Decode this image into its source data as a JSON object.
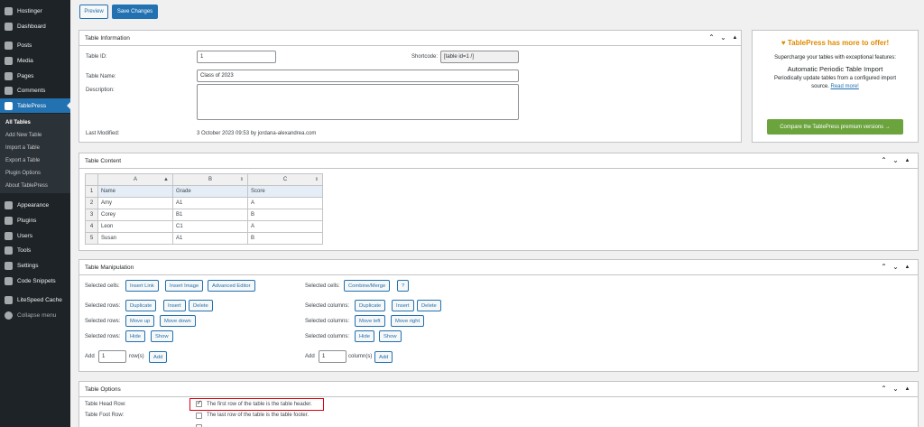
{
  "sidebar": {
    "top": [
      {
        "label": "Hostinger",
        "icon": "hostinger-icon"
      },
      {
        "label": "Dashboard",
        "icon": "dashboard-icon"
      },
      {
        "label": "Posts",
        "icon": "pin-icon"
      },
      {
        "label": "Media",
        "icon": "media-icon"
      },
      {
        "label": "Pages",
        "icon": "pages-icon"
      },
      {
        "label": "Comments",
        "icon": "comments-icon"
      },
      {
        "label": "TablePress",
        "icon": "tablepress-icon"
      }
    ],
    "submenu": [
      "All Tables",
      "Add New Table",
      "Import a Table",
      "Export a Table",
      "Plugin Options",
      "About TablePress"
    ],
    "bottom": [
      {
        "label": "Appearance",
        "icon": "brush-icon"
      },
      {
        "label": "Plugins",
        "icon": "plug-icon"
      },
      {
        "label": "Users",
        "icon": "users-icon"
      },
      {
        "label": "Tools",
        "icon": "wrench-icon"
      },
      {
        "label": "Settings",
        "icon": "settings-icon"
      },
      {
        "label": "Code Snippets",
        "icon": "code-icon"
      },
      {
        "label": "LiteSpeed Cache",
        "icon": "litespeed-icon"
      },
      {
        "label": "Collapse menu",
        "icon": "collapse-icon"
      }
    ]
  },
  "toolbar": {
    "preview_label": "Preview",
    "save_label": "Save Changes"
  },
  "info": {
    "title": "Table Information",
    "id_label": "Table ID:",
    "id_value": "1",
    "shortcode_label": "Shortcode:",
    "shortcode_value": "[table id=1 /]",
    "name_label": "Table Name:",
    "name_value": "Class of 2023",
    "desc_label": "Description:",
    "desc_value": "",
    "modified_label": "Last Modified:",
    "modified_value": "3 October 2023 09:53 by jordana-alexandrea.com"
  },
  "promo": {
    "title": "TablePress has more to offer!",
    "line1": "Supercharge your tables with exceptional features:",
    "feature": "Automatic Periodic Table Import",
    "desc1": "Periodically update tables from a configured import",
    "desc2_prefix": "source.",
    "link": "Read more!",
    "button": "Compare the TablePress premium versions"
  },
  "content": {
    "title": "Table Content",
    "columns": [
      "A",
      "B",
      "C"
    ],
    "rows": [
      {
        "num": "1",
        "cells": [
          "Name",
          "Grade",
          "Score"
        ]
      },
      {
        "num": "2",
        "cells": [
          "Amy",
          "A1",
          "A"
        ]
      },
      {
        "num": "3",
        "cells": [
          "Corey",
          "B1",
          "B"
        ]
      },
      {
        "num": "4",
        "cells": [
          "Leon",
          "C1",
          "A"
        ]
      },
      {
        "num": "5",
        "cells": [
          "Susan",
          "A1",
          "B"
        ]
      }
    ]
  },
  "manip": {
    "title": "Table Manipulation",
    "sel_cells": "Selected cells:",
    "insert_link": "Insert Link",
    "insert_image": "Insert Image",
    "advanced_editor": "Advanced Editor",
    "combine_merge": "Combine/Merge",
    "help": "?",
    "sel_rows": "Selected rows:",
    "sel_columns": "Selected columns:",
    "duplicate": "Duplicate",
    "insert": "Insert",
    "delete": "Delete",
    "move_up": "Move up",
    "move_down": "Move down",
    "move_left": "Move left",
    "move_right": "Move right",
    "hide": "Hide",
    "show": "Show",
    "add": "Add",
    "rows_value": "1",
    "rows_unit": "row(s)",
    "cols_value": "1",
    "cols_unit": "column(s)"
  },
  "options": {
    "title": "Table Options",
    "head_label": "Table Head Row:",
    "head_text": "The first row of the table is the table header.",
    "head_checked": true,
    "foot_label": "Table Foot Row:",
    "foot_text": "The last row of the table is the table footer.",
    "foot_checked": false
  }
}
